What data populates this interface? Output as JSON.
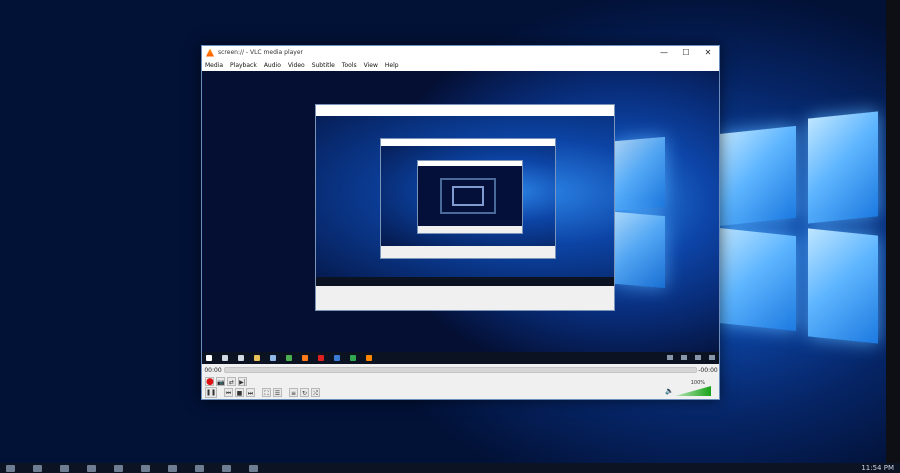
{
  "window": {
    "title": "screen:// - VLC media player",
    "controls": {
      "minimize": "—",
      "maximize": "☐",
      "close": "✕"
    }
  },
  "menu": {
    "items": [
      {
        "label": "Media"
      },
      {
        "label": "Playback"
      },
      {
        "label": "Audio"
      },
      {
        "label": "Video"
      },
      {
        "label": "Subtitle"
      },
      {
        "label": "Tools"
      },
      {
        "label": "View"
      },
      {
        "label": "Help"
      }
    ]
  },
  "player": {
    "elapsed": "00:00",
    "remaining": "-00:00",
    "volume_percent": "100%",
    "volume_level": 1.0
  },
  "icons": {
    "record": "●",
    "snapshot": "📷",
    "loop_ab": "⇄",
    "frame_step": "▶|",
    "pause": "❚❚",
    "prev": "⏮",
    "stop": "■",
    "next": "⏭",
    "fullscreen": "⛶",
    "extended": "☰",
    "playlist": "≡",
    "loop": "↻",
    "shuffle": "⤮",
    "speaker": "🔈"
  },
  "desktop": {
    "clock": "11:54 PM",
    "accent": "#1d6fd6"
  }
}
